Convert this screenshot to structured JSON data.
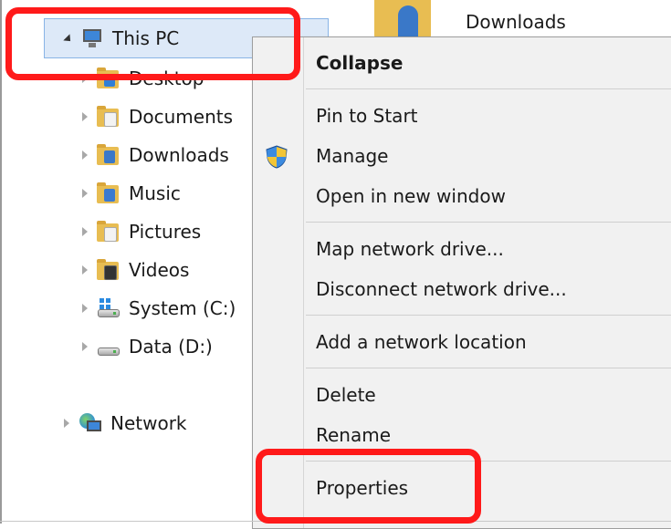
{
  "nav": {
    "this_pc": "This PC",
    "items": [
      {
        "label": "Desktop"
      },
      {
        "label": "Documents"
      },
      {
        "label": "Downloads"
      },
      {
        "label": "Music"
      },
      {
        "label": "Pictures"
      },
      {
        "label": "Videos"
      },
      {
        "label": "System (C:)"
      },
      {
        "label": "Data (D:)"
      }
    ],
    "network": "Network"
  },
  "content": {
    "top_item": "Downloads"
  },
  "context_menu": {
    "items": [
      {
        "label": "Collapse"
      },
      {
        "label": "Pin to Start"
      },
      {
        "label": "Manage"
      },
      {
        "label": "Open in new window"
      },
      {
        "label": "Map network drive..."
      },
      {
        "label": "Disconnect network drive..."
      },
      {
        "label": "Add a network location"
      },
      {
        "label": "Delete"
      },
      {
        "label": "Rename"
      },
      {
        "label": "Properties"
      }
    ]
  },
  "colors": {
    "highlight": "#ff1a1a",
    "selection": "#dde9f8",
    "menu_bg": "#f1f1f1"
  },
  "icons": {
    "this_pc": "computer-icon",
    "desktop": "desktop-folder-icon",
    "documents": "documents-folder-icon",
    "downloads": "downloads-folder-icon",
    "music": "music-folder-icon",
    "pictures": "pictures-folder-icon",
    "videos": "videos-folder-icon",
    "system": "windows-drive-icon",
    "data": "drive-icon",
    "network": "network-icon",
    "manage": "uac-shield-icon"
  }
}
